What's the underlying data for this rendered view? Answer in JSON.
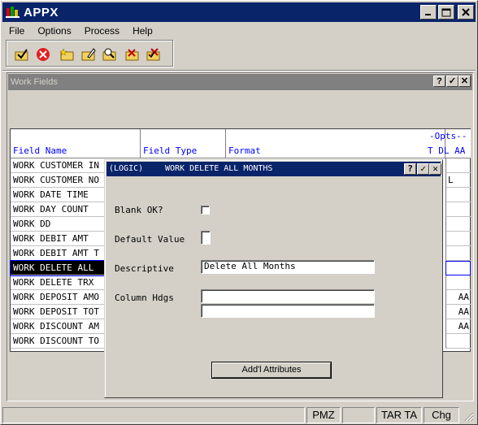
{
  "app": {
    "title": "APPX"
  },
  "menu": [
    "File",
    "Options",
    "Process",
    "Help"
  ],
  "toolbar": {
    "icons": [
      "check-folder-icon",
      "cancel-icon",
      "new-folder-icon",
      "edit-folder-icon",
      "find-folder-icon",
      "delete-folder-icon",
      "mark-folder-icon"
    ]
  },
  "child_window": {
    "title": "Work Fields",
    "buttons": {
      "help": "?",
      "ok": "✓",
      "close": "✕"
    }
  },
  "grid": {
    "headers": {
      "field_name": "Field Name",
      "field_type": "Field Type",
      "format": "Format",
      "opts": "-Opts--",
      "opts_cols": "T DL AA"
    },
    "rows": [
      {
        "name": "WORK CUSTOMER IN",
        "opts": ""
      },
      {
        "name": "WORK CUSTOMER NO",
        "opts": "L"
      },
      {
        "name": "WORK DATE TIME",
        "opts": ""
      },
      {
        "name": "WORK DAY COUNT",
        "opts": ""
      },
      {
        "name": "WORK DD",
        "opts": ""
      },
      {
        "name": "WORK DEBIT AMT",
        "opts": ""
      },
      {
        "name": "WORK DEBIT AMT T",
        "opts": ""
      },
      {
        "name": "WORK DELETE ALL",
        "opts": ""
      },
      {
        "name": "WORK DELETE TRX",
        "opts": ""
      },
      {
        "name": "WORK DEPOSIT AMO",
        "opts": "AA"
      },
      {
        "name": "WORK DEPOSIT TOT",
        "opts": "AA"
      },
      {
        "name": "WORK DISCOUNT AM",
        "opts": "AA"
      },
      {
        "name": "WORK DISCOUNT TO",
        "opts": ""
      }
    ]
  },
  "dialog": {
    "title_left": "(LOGIC)",
    "title_main": "WORK DELETE ALL MONTHS",
    "buttons": {
      "help": "?",
      "ok": "✓",
      "close": "✕"
    },
    "blank_ok_label": "Blank OK?",
    "default_value_label": "Default Value",
    "default_value": "",
    "descriptive_label": "Descriptive",
    "descriptive_value": "Delete All Months",
    "column_hdgs_label": "Column Hdgs",
    "column_hdg_1": "",
    "column_hdg_2": "",
    "addl_button": "Add'l Attributes"
  },
  "status": [
    "PMZ",
    "TAR TA",
    "Chg"
  ],
  "colors": {
    "titlebar": "#0a246a",
    "face": "#d4d0c8",
    "header_text": "#0000ff"
  }
}
